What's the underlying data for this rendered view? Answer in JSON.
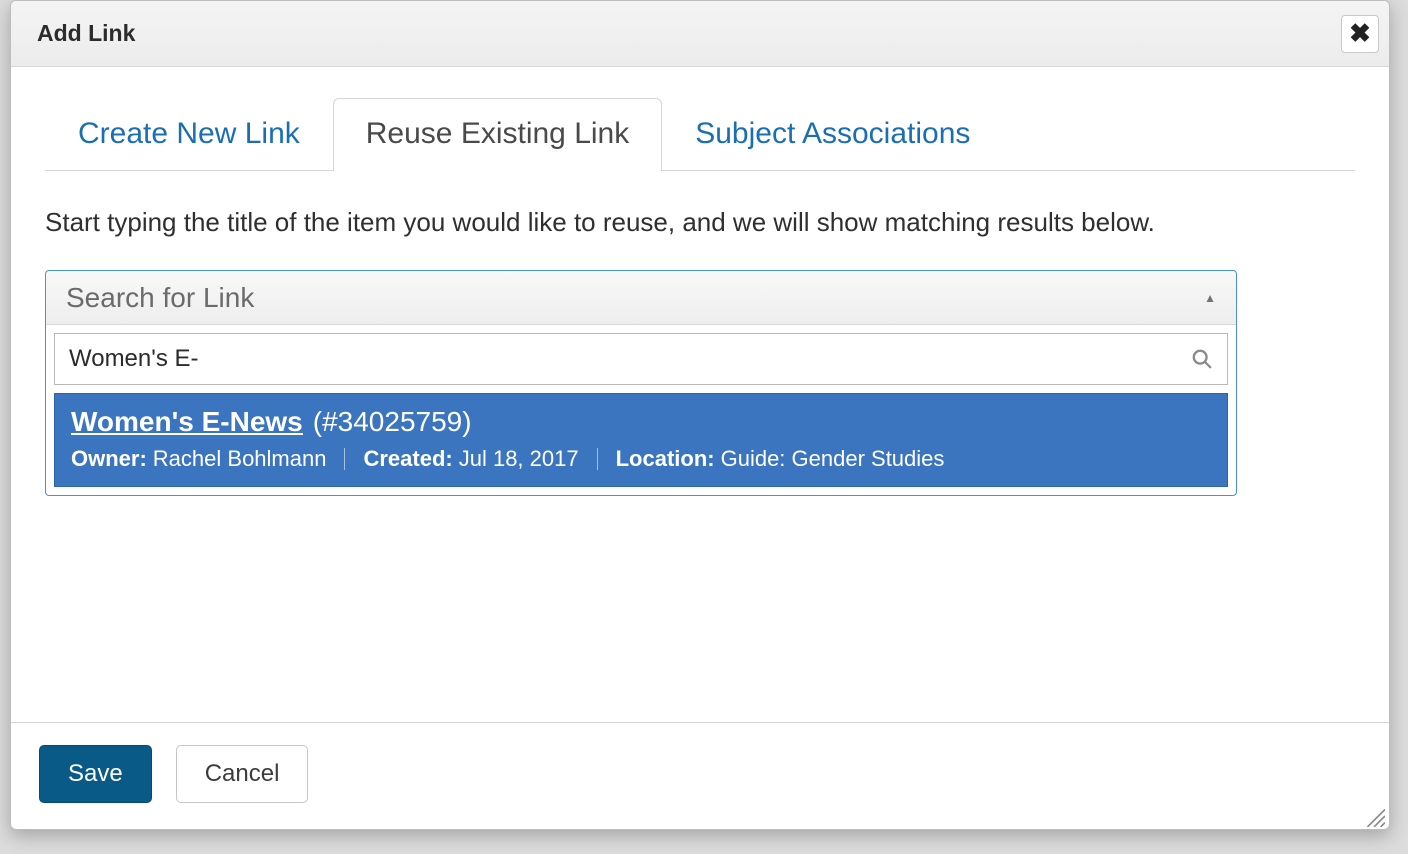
{
  "modal_title": "Add Link",
  "tabs": {
    "create": "Create New Link",
    "reuse": "Reuse Existing Link",
    "subject": "Subject Associations",
    "active": "reuse"
  },
  "instruction_text": "Start typing the title of the item you would like to reuse, and we will show matching results below.",
  "search": {
    "placeholder": "Search for Link",
    "value": "Women's E-"
  },
  "result": {
    "title_match": "Women's E-",
    "title_rest": "News",
    "id_text": "(#34025759)",
    "owner_label": "Owner:",
    "owner_value": "Rachel Bohlmann",
    "created_label": "Created:",
    "created_value": "Jul 18, 2017",
    "location_label": "Location:",
    "location_value": "Guide: Gender Studies"
  },
  "buttons": {
    "save": "Save",
    "cancel": "Cancel"
  },
  "colors": {
    "accent": "#1a6fb3",
    "result_bg": "#3b74bf",
    "save_bg": "#0a5a88"
  }
}
